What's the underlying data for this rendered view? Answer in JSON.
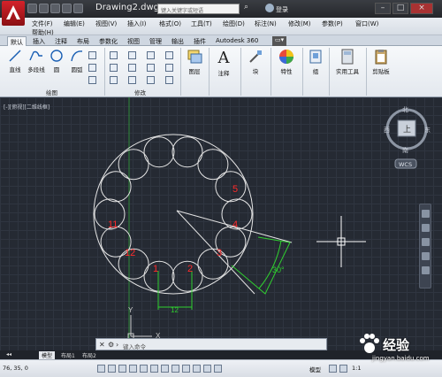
{
  "titlebar": {
    "doc_title": "Drawing2.dwg",
    "search_placeholder": "键入关键字或短语",
    "login": "登录"
  },
  "menu": {
    "items": [
      "文件(F)",
      "编辑(E)",
      "视图(V)",
      "插入(I)",
      "格式(O)",
      "工具(T)",
      "绘图(D)",
      "标注(N)",
      "修改(M)",
      "参数(P)",
      "窗口(W)"
    ],
    "help": "帮助(H)"
  },
  "ribbon_tabs": [
    "默认",
    "插入",
    "注释",
    "布局",
    "参数化",
    "视图",
    "管理",
    "输出",
    "插件",
    "Autodesk 360"
  ],
  "ribbon": {
    "draw_tools": [
      "直线",
      "多段线",
      "圆",
      "圆弧"
    ],
    "draw_panel": "绘图",
    "modify_panel": "修改",
    "layers": "图层",
    "annotation": "注释",
    "annotation_icon_text": "A",
    "block": "块",
    "properties": "特性",
    "group": "组",
    "utilities": "实用工具",
    "clipboard": "剪贴板"
  },
  "viewport": {
    "label": "[-][俯视][二维线框]",
    "viewcube": {
      "north": "北",
      "south": "南",
      "east": "东",
      "west": "西",
      "top": "上",
      "wcs": "WCS"
    },
    "circle_labels": [
      "1",
      "2",
      "3",
      "4",
      "5",
      "11",
      "12"
    ],
    "dim_12": "12",
    "dim_angle": "30°",
    "ucs_y": "Y",
    "ucs_x": "X"
  },
  "command": {
    "prompt": "键入命令"
  },
  "layout_tabs": [
    "模型",
    "布局1",
    "布局2"
  ],
  "status": {
    "coords": "76, 35, 0",
    "model": "模型",
    "scale": "1:1"
  },
  "watermark": {
    "text": "经验",
    "url": "jingyan.baidu.com"
  },
  "colors": {
    "accent_red": "#d4222a",
    "label_red": "#ff2a2a",
    "dimension_green": "#2fd02f",
    "geometry": "#e6e6e6"
  }
}
